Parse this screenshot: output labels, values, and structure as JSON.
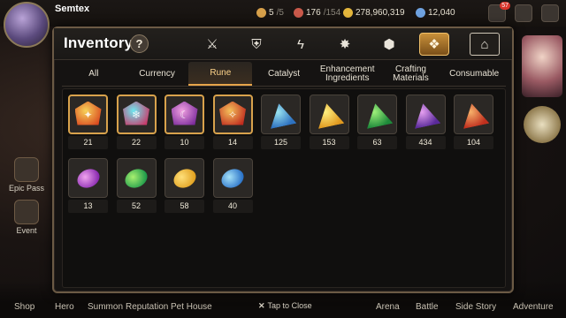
{
  "player": {
    "name": "Semtex"
  },
  "resources": [
    {
      "id": "stamina",
      "value": "5",
      "max": "/5",
      "color": "#d7a04a"
    },
    {
      "id": "energy",
      "value": "176",
      "max": "/154",
      "color": "#c9594a"
    },
    {
      "id": "gold",
      "value": "278,960,319",
      "max": "",
      "color": "#e4b63c"
    },
    {
      "id": "crystal",
      "value": "12,040",
      "max": "",
      "color": "#6fa2e0"
    }
  ],
  "top_badge": "57",
  "left_menu": [
    {
      "label": "Epic Pass",
      "icon": "epic-pass-icon"
    },
    {
      "label": "Event",
      "icon": "event-icon"
    }
  ],
  "bottom_nav": [
    "Shop",
    "Hero",
    "Summon",
    "Reputation",
    "Pet House",
    "Arena",
    "Battle",
    "Side Story",
    "Adventure"
  ],
  "close_hint": "Tap to Close",
  "inventory": {
    "title": "Inventory",
    "help": "?",
    "category_icons": [
      "equipment-icon",
      "artifact-icon",
      "lightning-icon",
      "burst-icon",
      "cube-icon",
      "rune-bag-icon",
      "house-icon"
    ],
    "active_category": 5,
    "tabs": [
      "All",
      "Currency",
      "Rune",
      "Catalyst",
      "Enhancement\nIngredients",
      "Crafting\nMaterials",
      "Consumable"
    ],
    "active_tab": 2,
    "items": [
      {
        "shape": "hex",
        "c1": "#f7d35a",
        "c2": "#d9471e",
        "glyph": "✦",
        "count": "21",
        "ring": true
      },
      {
        "shape": "hex",
        "c1": "#6ee8f0",
        "c2": "#c83a6a",
        "glyph": "❄",
        "count": "22",
        "ring": true
      },
      {
        "shape": "hex",
        "c1": "#f0a0e0",
        "c2": "#7a2a9a",
        "glyph": "☾",
        "count": "10",
        "ring": true
      },
      {
        "shape": "hex",
        "c1": "#f4c05a",
        "c2": "#c02a1e",
        "glyph": "✧",
        "count": "14",
        "ring": true
      },
      {
        "shape": "tri",
        "c1": "#9ae4f0",
        "c2": "#2e72c0",
        "glyph": "",
        "count": "125",
        "ring": false
      },
      {
        "shape": "tri",
        "c1": "#fff080",
        "c2": "#e09a20",
        "glyph": "",
        "count": "153",
        "ring": false
      },
      {
        "shape": "tri",
        "c1": "#9ef07a",
        "c2": "#1e8a3a",
        "glyph": "",
        "count": "63",
        "ring": false
      },
      {
        "shape": "tri",
        "c1": "#e6a0f0",
        "c2": "#5a2a9a",
        "glyph": "",
        "count": "434",
        "ring": false
      },
      {
        "shape": "tri",
        "c1": "#f6b06a",
        "c2": "#c0301e",
        "glyph": "",
        "count": "104",
        "ring": false
      },
      {
        "shape": "oval",
        "c1": "#f0a4ee",
        "c2": "#8a2ab0",
        "glyph": "",
        "count": "13",
        "ring": false
      },
      {
        "shape": "oval",
        "c1": "#a8f070",
        "c2": "#1e9a4a",
        "glyph": "",
        "count": "52",
        "ring": false
      },
      {
        "shape": "oval",
        "c1": "#ffe07a",
        "c2": "#e0a020",
        "glyph": "",
        "count": "58",
        "ring": false
      },
      {
        "shape": "oval",
        "c1": "#a6e2f8",
        "c2": "#2a72c8",
        "glyph": "",
        "count": "40",
        "ring": false
      }
    ]
  }
}
